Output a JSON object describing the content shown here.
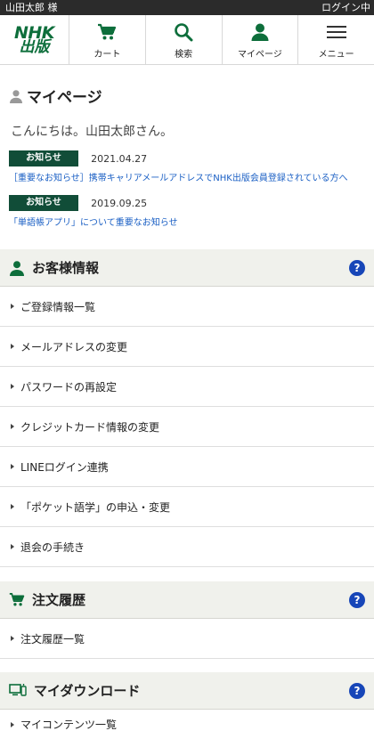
{
  "topbar": {
    "user": "山田太郎 様",
    "status": "ログイン中"
  },
  "header": {
    "logo_line1": "NHK",
    "logo_line2": "出版",
    "nav": [
      {
        "label": "カート",
        "icon": "cart-icon"
      },
      {
        "label": "検索",
        "icon": "search-icon"
      },
      {
        "label": "マイページ",
        "icon": "user-icon"
      },
      {
        "label": "メニュー",
        "icon": "menu-icon"
      }
    ]
  },
  "mypage": {
    "title": "マイページ",
    "greeting": "こんにちは。山田太郎さん。",
    "notices": [
      {
        "badge": "お知らせ",
        "date": "2021.04.27",
        "text": "［重要なお知らせ］携帯キャリアメールアドレスでNHK出版会員登録されている方へ"
      },
      {
        "badge": "お知らせ",
        "date": "2019.09.25",
        "text": "「単語帳アプリ」について重要なお知らせ"
      }
    ]
  },
  "sections": {
    "customer": {
      "title": "お客様情報",
      "help": "?",
      "items": [
        "ご登録情報一覧",
        "メールアドレスの変更",
        "パスワードの再設定",
        "クレジットカード情報の変更",
        "LINEログイン連携",
        "「ポケット語学」の申込・変更",
        "退会の手続き"
      ]
    },
    "orders": {
      "title": "注文履歴",
      "help": "?",
      "items": [
        "注文履歴一覧"
      ]
    },
    "downloads": {
      "title": "マイダウンロード",
      "help": "?",
      "items": [
        "マイコンテンツ一覧"
      ]
    }
  },
  "colors": {
    "brand_green": "#0d6e3b",
    "badge_green": "#114d38",
    "link_blue": "#1a5fc4",
    "help_blue": "#1746b8",
    "section_bg": "#f0f1ec"
  }
}
